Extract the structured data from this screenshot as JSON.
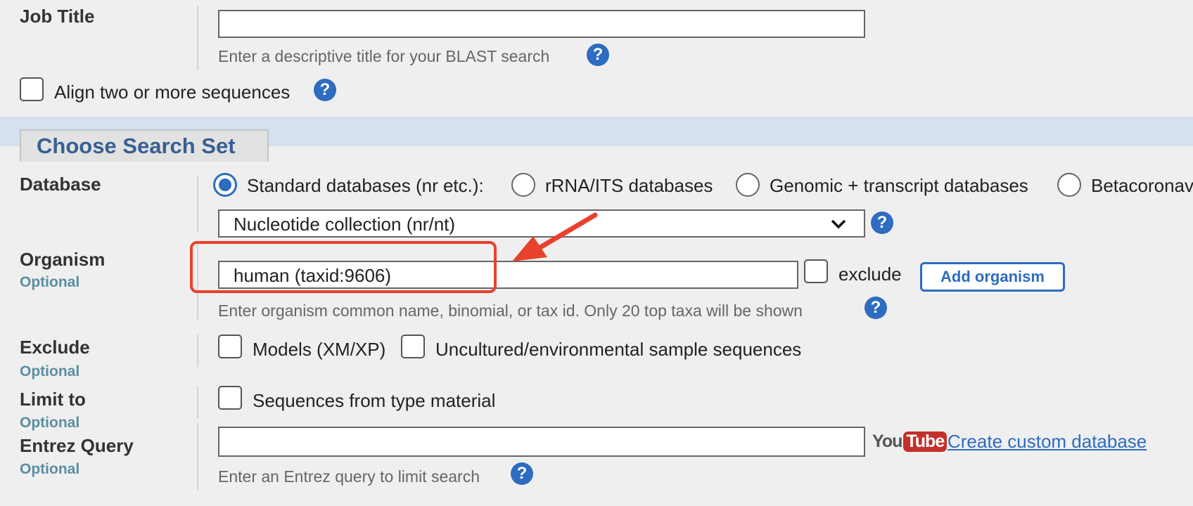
{
  "job_title": {
    "label": "Job Title",
    "value": "",
    "hint": "Enter a descriptive title for your BLAST search"
  },
  "align": {
    "label": "Align two or more sequences",
    "checked": false
  },
  "search_set": {
    "heading": "Choose Search Set"
  },
  "database": {
    "label": "Database",
    "options": [
      {
        "label": "Standard databases (nr etc.):",
        "selected": true
      },
      {
        "label": "rRNA/ITS databases",
        "selected": false
      },
      {
        "label": "Genomic + transcript databases",
        "selected": false
      },
      {
        "label": "Betacoronavirus",
        "selected": false
      }
    ],
    "selected_collection": "Nucleotide collection (nr/nt)"
  },
  "organism": {
    "label": "Organism",
    "optional": "Optional",
    "value": "human (taxid:9606)",
    "exclude_label": "exclude",
    "add_button": "Add organism",
    "hint": "Enter organism common name, binomial, or tax id. Only 20 top taxa will be shown"
  },
  "exclude": {
    "label": "Exclude",
    "optional": "Optional",
    "models": "Models (XM/XP)",
    "uncultured": "Uncultured/environmental sample sequences"
  },
  "limit": {
    "label": "Limit to",
    "optional": "Optional",
    "type_material": "Sequences from type material"
  },
  "entrez": {
    "label": "Entrez Query",
    "optional": "Optional",
    "value": "",
    "youtube_you": "You",
    "youtube_tube": "Tube",
    "custom_db_link": "Create custom database",
    "hint": "Enter an Entrez query to limit search"
  },
  "help_glyph": "?",
  "colors": {
    "accent": "#2d6cc0",
    "annotation": "#e8412c",
    "section_band": "#d5e0f1"
  }
}
